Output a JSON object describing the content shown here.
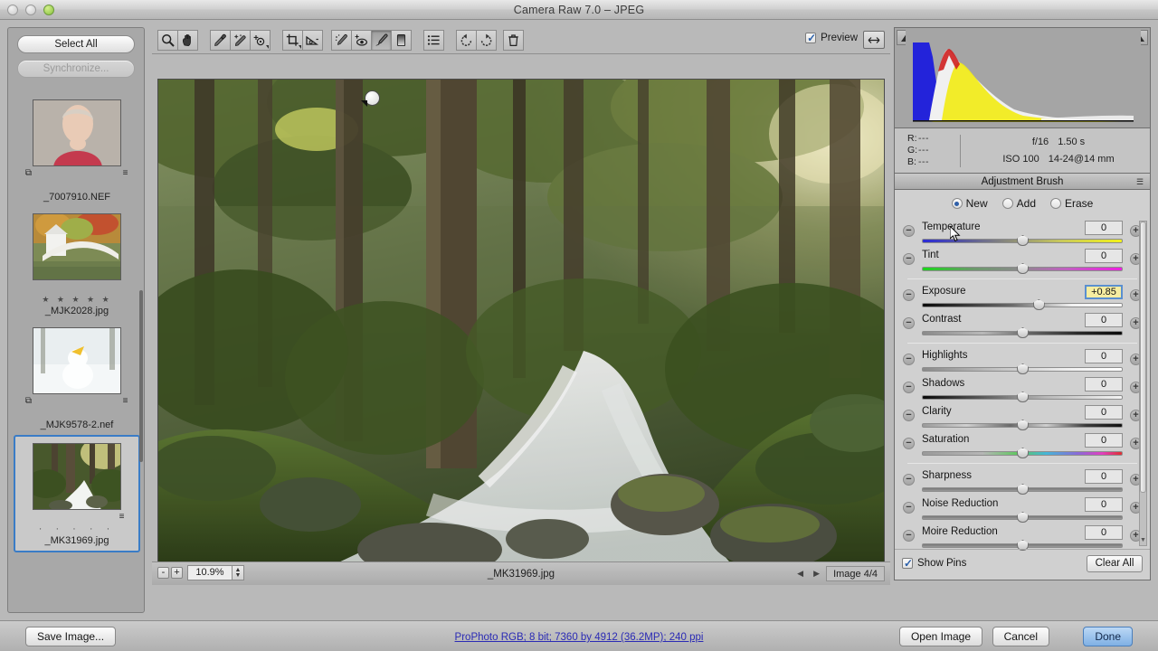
{
  "window": {
    "title": "Camera Raw 7.0  –  JPEG",
    "controls": [
      "close",
      "minimize",
      "zoom"
    ]
  },
  "filmstrip": {
    "select_all_label": "Select All",
    "synchronize_label": "Synchronize...",
    "synchronize_disabled": true,
    "thumbnails": [
      {
        "filename": "_7007910.NEF",
        "stars": "",
        "has_crop_badge": true,
        "has_adjust_badge": true,
        "selected": false,
        "kind": "portrait"
      },
      {
        "filename": "_MJK2028.jpg",
        "stars": "★ ★ ★ ★ ★",
        "has_crop_badge": false,
        "has_adjust_badge": false,
        "selected": false,
        "kind": "bridge"
      },
      {
        "filename": "_MJK9578-2.nef",
        "stars": "",
        "has_crop_badge": true,
        "has_adjust_badge": true,
        "selected": false,
        "kind": "snowman"
      },
      {
        "filename": "_MK31969.jpg",
        "stars": "· · · · ·",
        "has_crop_badge": false,
        "has_adjust_badge": true,
        "selected": true,
        "kind": "forest"
      }
    ]
  },
  "toolbar": {
    "tools": [
      {
        "name": "zoom-tool",
        "glyph": "magnifier",
        "active": false,
        "menu": false
      },
      {
        "name": "hand-tool",
        "glyph": "hand",
        "active": false,
        "menu": false
      },
      {
        "name": "white-balance-tool",
        "glyph": "eyedropper",
        "active": false,
        "menu": false
      },
      {
        "name": "color-sampler-tool",
        "glyph": "color-sampler",
        "active": false,
        "menu": false
      },
      {
        "name": "targeted-adjustment-tool",
        "glyph": "target",
        "active": false,
        "menu": true
      },
      {
        "name": "crop-tool",
        "glyph": "crop",
        "active": false,
        "menu": true
      },
      {
        "name": "straighten-tool",
        "glyph": "straighten",
        "active": false,
        "menu": false
      },
      {
        "name": "spot-removal-tool",
        "glyph": "spot-removal",
        "active": false,
        "menu": false
      },
      {
        "name": "red-eye-removal-tool",
        "glyph": "red-eye",
        "active": false,
        "menu": false
      },
      {
        "name": "adjustment-brush-tool",
        "glyph": "brush",
        "active": true,
        "menu": false
      },
      {
        "name": "graduated-filter-tool",
        "glyph": "graduated-filter",
        "active": false,
        "menu": false
      },
      {
        "name": "preferences-tool",
        "glyph": "list",
        "active": false,
        "menu": false
      },
      {
        "name": "rotate-counterclockwise-tool",
        "glyph": "rotate-ccw",
        "active": false,
        "menu": false
      },
      {
        "name": "rotate-clockwise-tool",
        "glyph": "rotate-cw",
        "active": false,
        "menu": false
      },
      {
        "name": "delete-tool",
        "glyph": "trash",
        "active": false,
        "menu": false
      }
    ],
    "preview_label": "Preview",
    "preview_checked": true
  },
  "statusbar": {
    "zoom_level": "10.9%",
    "zoom_out_label": "-",
    "zoom_in_label": "+",
    "filename": "_MK31969.jpg",
    "image_count": "Image 4/4",
    "prev_arrow": "◀",
    "next_arrow": "▶"
  },
  "histogram": {
    "shadow_clip_icon": "triangle-up",
    "highlight_clip_icon": "triangle-up"
  },
  "info": {
    "r_label": "R:",
    "r_value": "---",
    "g_label": "G:",
    "g_value": "---",
    "b_label": "B:",
    "b_value": "---",
    "aperture": "f/16",
    "shutter": "1.50 s",
    "iso": "ISO 100",
    "lens": "14-24@14 mm"
  },
  "panel": {
    "title": "Adjustment Brush",
    "modes": [
      {
        "label": "New",
        "selected": true
      },
      {
        "label": "Add",
        "selected": false
      },
      {
        "label": "Erase",
        "selected": false
      }
    ],
    "sliders": [
      {
        "label": "Temperature",
        "value": "0",
        "pos": 50,
        "track": "temperature",
        "highlighted": false
      },
      {
        "label": "Tint",
        "value": "0",
        "pos": 50,
        "track": "tint",
        "highlighted": false
      },
      {
        "label": "Exposure",
        "value": "+0.85",
        "pos": 58,
        "track": "exposure",
        "highlighted": true
      },
      {
        "label": "Contrast",
        "value": "0",
        "pos": 50,
        "track": "contrast",
        "highlighted": false
      },
      {
        "label": "Highlights",
        "value": "0",
        "pos": 50,
        "track": "highlights",
        "highlighted": false
      },
      {
        "label": "Shadows",
        "value": "0",
        "pos": 50,
        "track": "shadows",
        "highlighted": false
      },
      {
        "label": "Clarity",
        "value": "0",
        "pos": 50,
        "track": "clarity",
        "highlighted": false
      },
      {
        "label": "Saturation",
        "value": "0",
        "pos": 50,
        "track": "saturation",
        "highlighted": false
      },
      {
        "label": "Sharpness",
        "value": "0",
        "pos": 50,
        "track": "plain",
        "highlighted": false
      },
      {
        "label": "Noise Reduction",
        "value": "0",
        "pos": 50,
        "track": "plain",
        "highlighted": false
      },
      {
        "label": "Moire Reduction",
        "value": "0",
        "pos": 50,
        "track": "plain",
        "highlighted": false
      }
    ],
    "show_pins_label": "Show Pins",
    "show_pins_checked": true,
    "clear_all_label": "Clear All",
    "minus_label": "−",
    "plus_label": "+"
  },
  "bottom": {
    "save_image_label": "Save Image...",
    "workflow_options": "ProPhoto RGB; 8 bit; 7360 by 4912 (36.2MP); 240 ppi",
    "open_image_label": "Open Image",
    "cancel_label": "Cancel",
    "done_label": "Done"
  },
  "colors": {
    "accent": "#2f5fa8",
    "selection": "#3a7cc6",
    "link": "#2b2bb5",
    "highlight_field": "#f6eda1"
  }
}
